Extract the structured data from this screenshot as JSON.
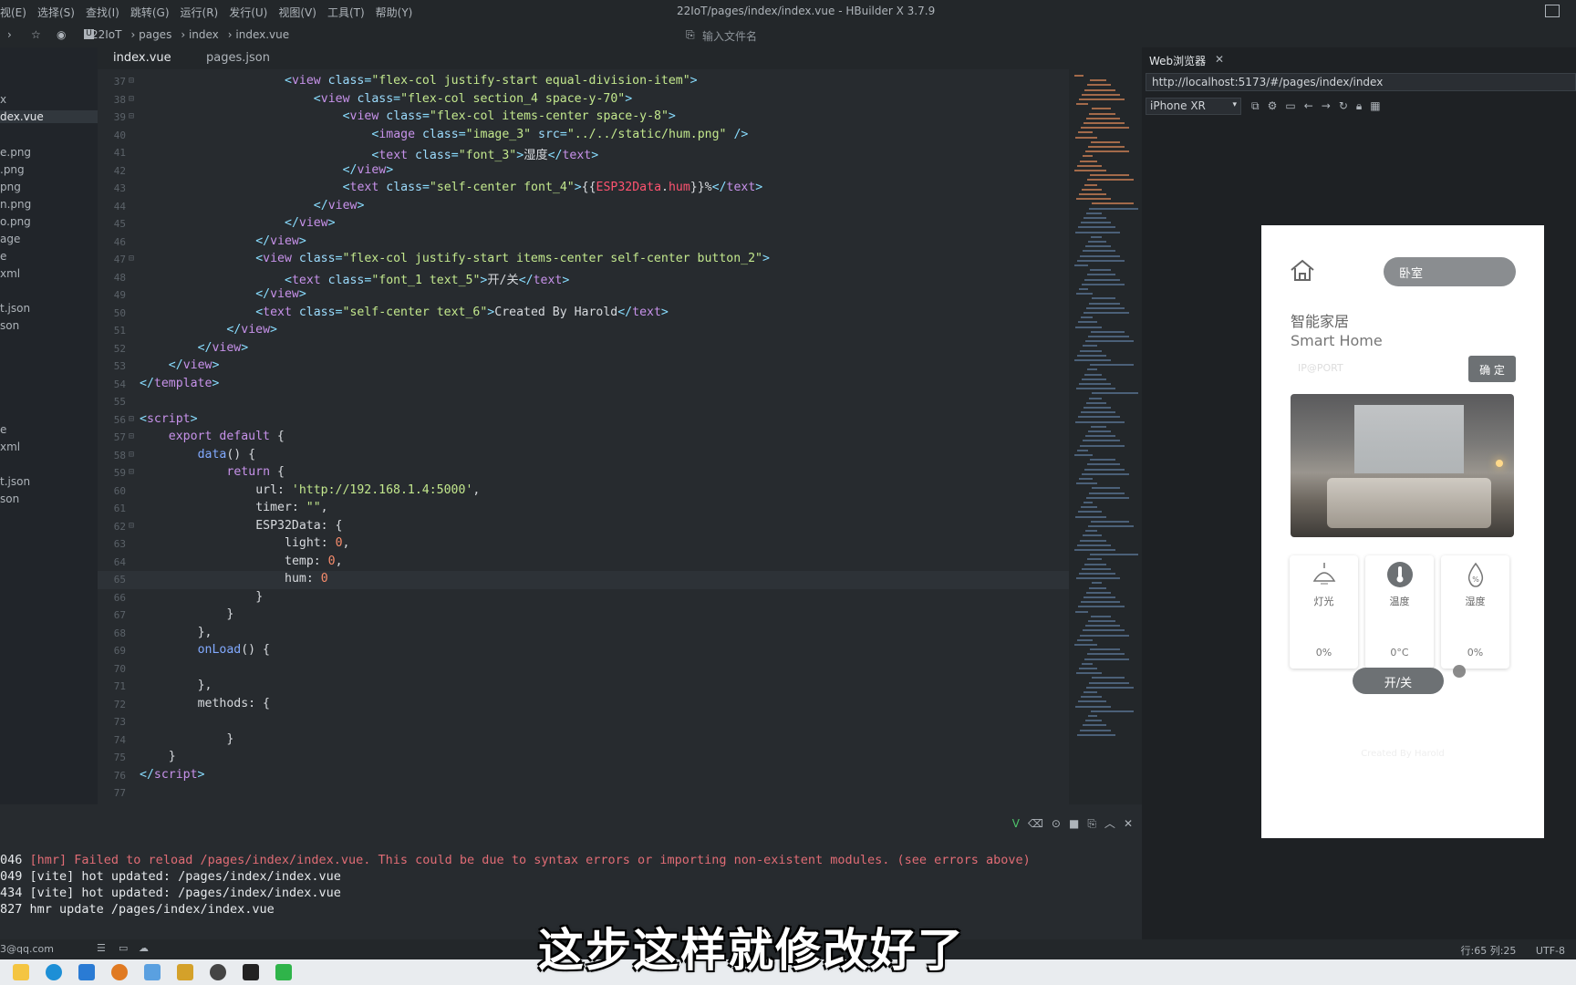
{
  "menubar": {
    "items": [
      "视(E)",
      "选择(S)",
      "查找(I)",
      "跳转(G)",
      "运行(R)",
      "发行(U)",
      "视图(V)",
      "工具(T)",
      "帮助(Y)"
    ],
    "window_title": "22IoT/pages/index/index.vue - HBuilder X 3.7.9"
  },
  "toolbar": {
    "breadcrumb": [
      "22IoT",
      "pages",
      "index",
      "index.vue"
    ],
    "file_input_placeholder": "输入文件名"
  },
  "sidebar": {
    "items": [
      "x",
      "dex.vue",
      "e.png",
      ".png",
      "png",
      "n.png",
      "o.png",
      "age",
      "e",
      "xml",
      "t.json",
      "son",
      "e",
      "xml",
      "t.json",
      "son"
    ]
  },
  "editor": {
    "tabs": [
      "index.vue",
      "pages.json"
    ],
    "lines": [
      {
        "n": "37",
        "fold": true,
        "indent": 10,
        "parts": [
          [
            "p",
            "<"
          ],
          [
            "t",
            "view"
          ],
          [
            "a",
            " class"
          ],
          [
            "p",
            "="
          ],
          [
            "s",
            "\"flex-col justify-start equal-division-item\""
          ],
          [
            "p",
            ">"
          ]
        ]
      },
      {
        "n": "38",
        "fold": true,
        "indent": 12,
        "parts": [
          [
            "p",
            "<"
          ],
          [
            "t",
            "view"
          ],
          [
            "a",
            " class"
          ],
          [
            "p",
            "="
          ],
          [
            "s",
            "\"flex-col section_4 space-y-70\""
          ],
          [
            "p",
            ">"
          ]
        ]
      },
      {
        "n": "39",
        "fold": true,
        "indent": 14,
        "parts": [
          [
            "p",
            "<"
          ],
          [
            "t",
            "view"
          ],
          [
            "a",
            " class"
          ],
          [
            "p",
            "="
          ],
          [
            "s",
            "\"flex-col items-center space-y-8\""
          ],
          [
            "p",
            ">"
          ]
        ]
      },
      {
        "n": "40",
        "fold": false,
        "indent": 16,
        "parts": [
          [
            "p",
            "<"
          ],
          [
            "t",
            "image"
          ],
          [
            "a",
            " class"
          ],
          [
            "p",
            "="
          ],
          [
            "s",
            "\"image_3\""
          ],
          [
            "a",
            " src"
          ],
          [
            "p",
            "="
          ],
          [
            "s",
            "\"../../static/hum.png\""
          ],
          [
            "p",
            " />"
          ]
        ]
      },
      {
        "n": "41",
        "fold": false,
        "indent": 16,
        "parts": [
          [
            "p",
            "<"
          ],
          [
            "t",
            "text"
          ],
          [
            "a",
            " class"
          ],
          [
            "p",
            "="
          ],
          [
            "s",
            "\"font_3\""
          ],
          [
            "p",
            ">"
          ],
          [
            "txt",
            "湿度"
          ],
          [
            "p",
            "</"
          ],
          [
            "t",
            "text"
          ],
          [
            "p",
            ">"
          ]
        ]
      },
      {
        "n": "42",
        "fold": false,
        "indent": 14,
        "parts": [
          [
            "p",
            "</"
          ],
          [
            "t",
            "view"
          ],
          [
            "p",
            ">"
          ]
        ]
      },
      {
        "n": "43",
        "fold": false,
        "indent": 14,
        "parts": [
          [
            "p",
            "<"
          ],
          [
            "t",
            "text"
          ],
          [
            "a",
            " class"
          ],
          [
            "p",
            "="
          ],
          [
            "s",
            "\"self-center font_4\""
          ],
          [
            "p",
            ">"
          ],
          [
            "txt",
            "{{"
          ],
          [
            "r",
            "ESP32Data"
          ],
          [
            "txt",
            "."
          ],
          [
            "r",
            "hum"
          ],
          [
            "txt",
            "}}%"
          ],
          [
            "p",
            "</"
          ],
          [
            "t",
            "text"
          ],
          [
            "p",
            ">"
          ]
        ]
      },
      {
        "n": "44",
        "fold": false,
        "indent": 12,
        "parts": [
          [
            "p",
            "</"
          ],
          [
            "t",
            "view"
          ],
          [
            "p",
            ">"
          ]
        ]
      },
      {
        "n": "45",
        "fold": false,
        "indent": 10,
        "parts": [
          [
            "p",
            "</"
          ],
          [
            "t",
            "view"
          ],
          [
            "p",
            ">"
          ]
        ]
      },
      {
        "n": "46",
        "fold": false,
        "indent": 8,
        "parts": [
          [
            "p",
            "</"
          ],
          [
            "t",
            "view"
          ],
          [
            "p",
            ">"
          ]
        ]
      },
      {
        "n": "47",
        "fold": true,
        "indent": 8,
        "parts": [
          [
            "p",
            "<"
          ],
          [
            "t",
            "view"
          ],
          [
            "a",
            " class"
          ],
          [
            "p",
            "="
          ],
          [
            "s",
            "\"flex-col justify-start items-center self-center button_2\""
          ],
          [
            "p",
            ">"
          ]
        ]
      },
      {
        "n": "48",
        "fold": false,
        "indent": 10,
        "parts": [
          [
            "p",
            "<"
          ],
          [
            "t",
            "text"
          ],
          [
            "a",
            " class"
          ],
          [
            "p",
            "="
          ],
          [
            "s",
            "\"font_1 text_5\""
          ],
          [
            "p",
            ">"
          ],
          [
            "txt",
            "开/关"
          ],
          [
            "p",
            "</"
          ],
          [
            "t",
            "text"
          ],
          [
            "p",
            ">"
          ]
        ]
      },
      {
        "n": "49",
        "fold": false,
        "indent": 8,
        "parts": [
          [
            "p",
            "</"
          ],
          [
            "t",
            "view"
          ],
          [
            "p",
            ">"
          ]
        ]
      },
      {
        "n": "50",
        "fold": false,
        "indent": 8,
        "parts": [
          [
            "p",
            "<"
          ],
          [
            "t",
            "text"
          ],
          [
            "a",
            " class"
          ],
          [
            "p",
            "="
          ],
          [
            "s",
            "\"self-center text_6\""
          ],
          [
            "p",
            ">"
          ],
          [
            "txt",
            "Created By Harold"
          ],
          [
            "p",
            "</"
          ],
          [
            "t",
            "text"
          ],
          [
            "p",
            ">"
          ]
        ]
      },
      {
        "n": "51",
        "fold": false,
        "indent": 6,
        "parts": [
          [
            "p",
            "</"
          ],
          [
            "t",
            "view"
          ],
          [
            "p",
            ">"
          ]
        ]
      },
      {
        "n": "52",
        "fold": false,
        "indent": 4,
        "parts": [
          [
            "p",
            "</"
          ],
          [
            "t",
            "view"
          ],
          [
            "p",
            ">"
          ]
        ]
      },
      {
        "n": "53",
        "fold": false,
        "indent": 2,
        "parts": [
          [
            "p",
            "</"
          ],
          [
            "t",
            "view"
          ],
          [
            "p",
            ">"
          ]
        ]
      },
      {
        "n": "54",
        "fold": false,
        "indent": 0,
        "parts": [
          [
            "p",
            "</"
          ],
          [
            "t",
            "template"
          ],
          [
            "p",
            ">"
          ]
        ]
      },
      {
        "n": "55",
        "fold": false,
        "indent": 0,
        "parts": []
      },
      {
        "n": "56",
        "fold": true,
        "indent": 0,
        "parts": [
          [
            "p",
            "<"
          ],
          [
            "t",
            "script"
          ],
          [
            "p",
            ">"
          ]
        ]
      },
      {
        "n": "57",
        "fold": true,
        "indent": 2,
        "parts": [
          [
            "k",
            "export default"
          ],
          [
            "txt",
            " {"
          ]
        ]
      },
      {
        "n": "58",
        "fold": true,
        "indent": 4,
        "parts": [
          [
            "f",
            "data"
          ],
          [
            "txt",
            "() {"
          ]
        ]
      },
      {
        "n": "59",
        "fold": true,
        "indent": 6,
        "parts": [
          [
            "k",
            "return"
          ],
          [
            "txt",
            " {"
          ]
        ]
      },
      {
        "n": "60",
        "fold": false,
        "indent": 8,
        "parts": [
          [
            "txt",
            "url: "
          ],
          [
            "s",
            "'http://192.168.1.4:5000'"
          ],
          [
            "txt",
            ","
          ]
        ]
      },
      {
        "n": "61",
        "fold": false,
        "indent": 8,
        "parts": [
          [
            "txt",
            "timer: "
          ],
          [
            "s",
            "\"\""
          ],
          [
            "txt",
            ","
          ]
        ]
      },
      {
        "n": "62",
        "fold": true,
        "indent": 8,
        "parts": [
          [
            "txt",
            "ESP32Data: {"
          ]
        ]
      },
      {
        "n": "63",
        "fold": false,
        "indent": 10,
        "parts": [
          [
            "txt",
            "light: "
          ],
          [
            "n",
            "0"
          ],
          [
            "txt",
            ","
          ]
        ]
      },
      {
        "n": "64",
        "fold": false,
        "indent": 10,
        "parts": [
          [
            "txt",
            "temp: "
          ],
          [
            "n",
            "0"
          ],
          [
            "txt",
            ","
          ]
        ]
      },
      {
        "n": "65",
        "fold": false,
        "indent": 10,
        "parts": [
          [
            "txt",
            "hum: "
          ],
          [
            "n",
            "0"
          ]
        ]
      },
      {
        "n": "66",
        "fold": false,
        "indent": 8,
        "parts": [
          [
            "txt",
            "}"
          ]
        ]
      },
      {
        "n": "67",
        "fold": false,
        "indent": 6,
        "parts": [
          [
            "txt",
            "}"
          ]
        ]
      },
      {
        "n": "68",
        "fold": false,
        "indent": 4,
        "parts": [
          [
            "txt",
            "},"
          ]
        ]
      },
      {
        "n": "69",
        "fold": false,
        "indent": 4,
        "parts": [
          [
            "f",
            "onLoad"
          ],
          [
            "txt",
            "() {"
          ]
        ]
      },
      {
        "n": "70",
        "fold": false,
        "indent": 0,
        "parts": []
      },
      {
        "n": "71",
        "fold": false,
        "indent": 4,
        "parts": [
          [
            "txt",
            "},"
          ]
        ]
      },
      {
        "n": "72",
        "fold": false,
        "indent": 4,
        "parts": [
          [
            "txt",
            "methods: {"
          ]
        ]
      },
      {
        "n": "73",
        "fold": false,
        "indent": 0,
        "parts": []
      },
      {
        "n": "74",
        "fold": false,
        "indent": 6,
        "parts": [
          [
            "txt",
            "}"
          ]
        ]
      },
      {
        "n": "75",
        "fold": false,
        "indent": 2,
        "parts": [
          [
            "txt",
            "}"
          ]
        ]
      },
      {
        "n": "76",
        "fold": false,
        "indent": 0,
        "parts": [
          [
            "p",
            "</"
          ],
          [
            "t",
            "script"
          ],
          [
            "p",
            ">"
          ]
        ]
      },
      {
        "n": "77",
        "fold": false,
        "indent": 0,
        "parts": []
      }
    ],
    "current_line": "65"
  },
  "browser": {
    "tab_title": "Web浏览器",
    "url": "http://localhost:5173/#/pages/index/index",
    "device": "iPhone XR"
  },
  "app": {
    "room_button": "卧室",
    "title_cn": "智能家居",
    "title_en": "Smart Home",
    "ip_placeholder": "IP@PORT",
    "confirm_button": "确 定",
    "sensors": [
      {
        "label": "灯光",
        "value": "0%",
        "icon": "lamp-icon"
      },
      {
        "label": "温度",
        "value": "0°C",
        "icon": "thermometer-icon"
      },
      {
        "label": "湿度",
        "value": "0%",
        "icon": "humidity-icon"
      }
    ],
    "power_button": "开/关",
    "credit": "Created By Harold"
  },
  "terminal": {
    "lines": [
      {
        "prefix": "046",
        "text": "[hmr] Failed to reload /pages/index/index.vue. This could be due to syntax errors or importing non-existent modules. (see errors above)",
        "error": true
      },
      {
        "prefix": "049",
        "text": "[vite] hot updated: /pages/index/index.vue",
        "error": false
      },
      {
        "prefix": "434",
        "text": "[vite] hot updated: /pages/index/index.vue",
        "error": false
      },
      {
        "prefix": "827",
        "text": "hmr update /pages/index/index.vue",
        "error": false
      }
    ]
  },
  "statusbar": {
    "account": "3@qq.com",
    "position": "行:65  列:25",
    "encoding": "UTF-8"
  },
  "caption": "这步这样就修改好了"
}
